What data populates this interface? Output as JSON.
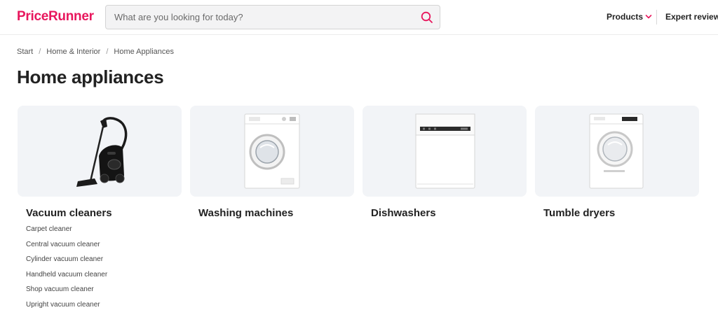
{
  "header": {
    "logo": "PriceRunner",
    "search_placeholder": "What are you looking for today?",
    "nav": {
      "products_label": "Products",
      "expert_label": "Expert reviews"
    }
  },
  "breadcrumb": [
    "Start",
    "Home & Interior",
    "Home Appliances"
  ],
  "page_title": "Home appliances",
  "categories": [
    {
      "title": "Vacuum cleaners",
      "icon": "vacuum-cleaner-image",
      "subcategories": [
        "Carpet cleaner",
        "Central vacuum cleaner",
        "Cylinder vacuum cleaner",
        "Handheld vacuum cleaner",
        "Shop vacuum cleaner",
        "Upright vacuum cleaner"
      ]
    },
    {
      "title": "Washing machines",
      "icon": "washing-machine-image"
    },
    {
      "title": "Dishwashers",
      "icon": "dishwasher-image"
    },
    {
      "title": "Tumble dryers",
      "icon": "tumble-dryer-image"
    }
  ],
  "colors": {
    "brand": "#e8175d",
    "card_bg": "#f2f4f7",
    "text": "#222222"
  }
}
